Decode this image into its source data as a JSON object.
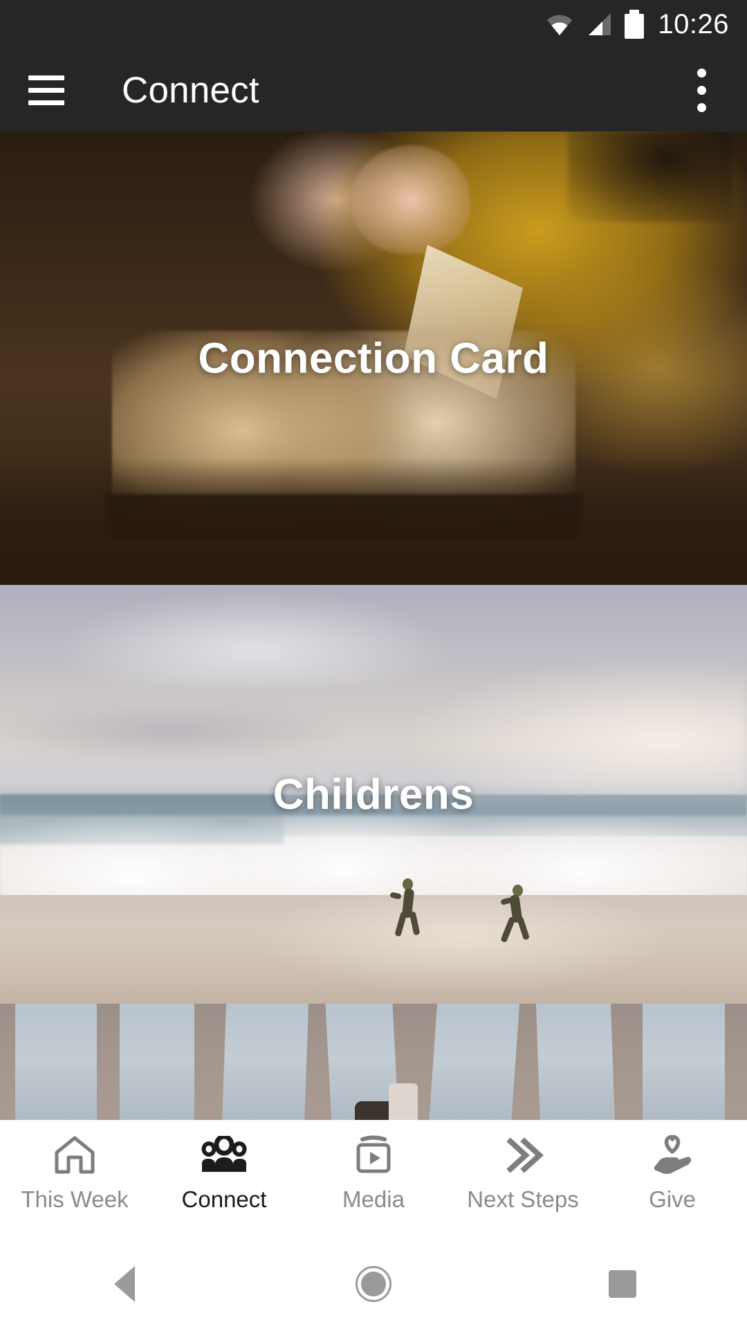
{
  "status_bar": {
    "time": "10:26",
    "icons": [
      "wifi-icon",
      "cellular-signal-icon",
      "battery-icon"
    ]
  },
  "app_bar": {
    "menu_icon": "hamburger-menu-icon",
    "title": "Connect",
    "overflow_icon": "more-vertical-icon"
  },
  "cards": [
    {
      "label": "Connection Card",
      "image_description": "person in yellow shirt reading an open bible on a dark wooden table"
    },
    {
      "label": "Childrens",
      "image_description": "beach with crashing waves and two children running on the sand"
    },
    {
      "label": "",
      "image_description": "legs in light blue jeans standing on concrete"
    }
  ],
  "tab_bar": {
    "active_index": 1,
    "tabs": [
      {
        "label": "This Week",
        "icon": "home-icon"
      },
      {
        "label": "Connect",
        "icon": "people-group-icon"
      },
      {
        "label": "Media",
        "icon": "video-play-icon"
      },
      {
        "label": "Next Steps",
        "icon": "double-chevron-right-icon"
      },
      {
        "label": "Give",
        "icon": "hand-heart-icon"
      }
    ]
  },
  "android_nav": {
    "back": "back-triangle-icon",
    "home": "home-circle-icon",
    "recents": "recents-square-icon"
  },
  "colors": {
    "app_bar_bg": "#262626",
    "tab_bar_bg": "#ffffff",
    "tab_active": "#1a1a1a",
    "tab_inactive": "#8a8a8a",
    "nav_icon": "#9a9a9a",
    "card_label": "#ffffff"
  }
}
